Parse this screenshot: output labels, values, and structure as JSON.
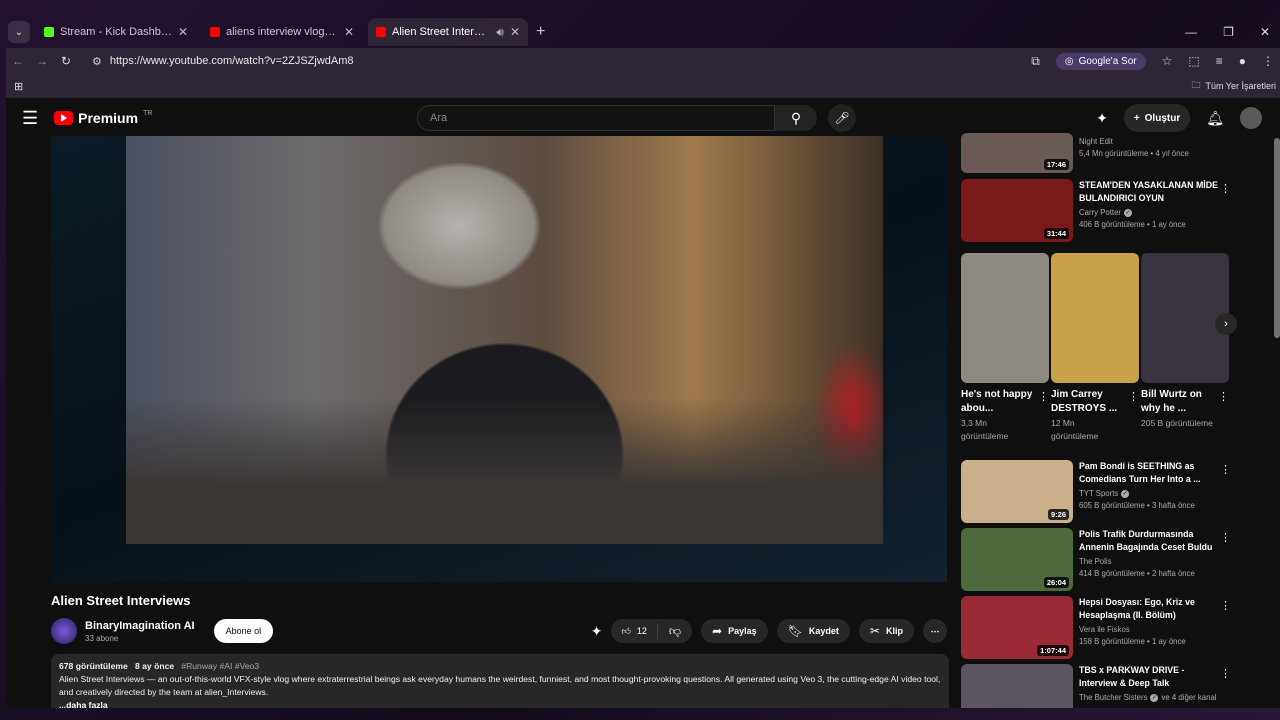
{
  "browser": {
    "tabs": [
      {
        "title": "Stream - Kick Dashboard",
        "color": "#53fc18",
        "active": false
      },
      {
        "title": "aliens interview vlog - YouTube",
        "color": "#ff0000",
        "active": false
      },
      {
        "title": "Alien Street Interviews - YouTube",
        "color": "#ff0000",
        "active": true
      }
    ],
    "url": "https://www.youtube.com/watch?v=2ZJSZjwdAm8",
    "google_button": "Google'a Sor",
    "all_bookmarks": "Tüm Yer İşaretleri"
  },
  "youtube": {
    "logo_text": "Premium",
    "region": "TR",
    "search_placeholder": "Ara",
    "create_label": "Oluştur"
  },
  "video": {
    "title": "Alien Street Interviews",
    "channel": "BinaryImagination AI",
    "subscribers": "33 abone",
    "subscribe_label": "Abone ol",
    "likes": "12",
    "share_label": "Paylaş",
    "save_label": "Kaydet",
    "clip_label": "Klip",
    "views": "678 görüntüleme",
    "age": "8 ay önce",
    "tags": "#Runway #AI #Veo3",
    "description": "Alien Street Interviews — an out-of-this-world VFX-style vlog where extraterrestrial beings ask everyday humans the weirdest, funniest, and most thought-provoking questions. All generated using Veo 3, the cutting-edge AI video tool, and creatively directed by the team at alien_Interviews.",
    "more": "...daha fazla"
  },
  "sidebar": {
    "top_partial": {
      "channel": "Night Edit",
      "views": "5,4 Mn görüntüleme • 4 yıl önce",
      "duration": "17:46",
      "thumb_color": "#6a5a56"
    },
    "videos_a": [
      {
        "title": "STEAM'DEN YASAKLANAN MİDE BULANDIRICI OYUN",
        "channel": "Carry Potter",
        "verified": true,
        "views": "406 B görüntüleme • 1 ay önce",
        "duration": "31:44",
        "thumb_color": "#7a1a1a"
      }
    ],
    "shorts": [
      {
        "title": "He's not happy abou...",
        "views": "3,3 Mn görüntüleme",
        "thumb_color": "#8e8a82"
      },
      {
        "title": "Jim Carrey DESTROYS ...",
        "views": "12 Mn görüntüleme",
        "thumb_color": "#c8a24a"
      },
      {
        "title": "Bill Wurtz on why he ...",
        "views": "205 B görüntüleme",
        "thumb_color": "#3a3340"
      }
    ],
    "videos_b": [
      {
        "title": "Pam Bondi is SEETHING as Comedians Turn Her Into a ...",
        "channel": "TYT Sports",
        "verified": true,
        "views": "605 B görüntüleme • 3 hafta önce",
        "duration": "9:26",
        "thumb_color": "#c9b08a"
      },
      {
        "title": "Polis Trafik Durdurmasında Annenin Bagajında Ceset Buldu",
        "channel": "The Polis",
        "verified": false,
        "views": "414 B görüntüleme • 2 hafta önce",
        "duration": "26:04",
        "thumb_color": "#4e6a3c"
      },
      {
        "title": "Hepsi Dosyası: Ego, Kriz ve Hesaplaşma (II. Bölüm)",
        "channel": "Vera ile Fiskos",
        "verified": false,
        "views": "158 B görüntüleme • 1 ay önce",
        "duration": "1:07:44",
        "thumb_color": "#9a2a35"
      },
      {
        "title": "TBS x PARKWAY DRIVE - Interview & Deep Talk",
        "channel": "The Butcher Sisters",
        "verified": true,
        "views": "ve 4 diğer kanal",
        "duration": "",
        "thumb_color": "#5a5560"
      }
    ]
  }
}
